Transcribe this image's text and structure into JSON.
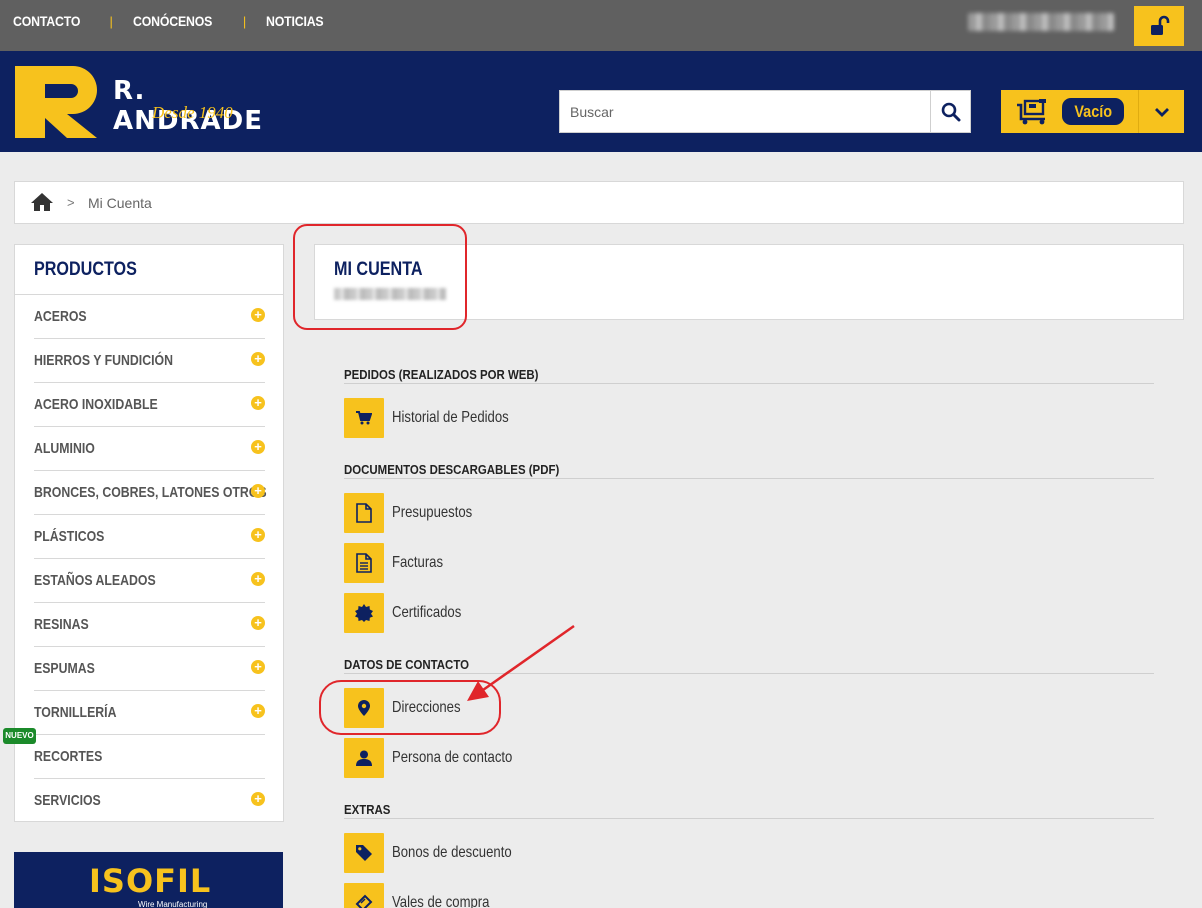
{
  "top_nav": {
    "items": [
      "CONTACTO",
      "CONÓCENOS",
      "NOTICIAS"
    ],
    "separator": "|"
  },
  "brand": {
    "name": "R. ANDRADE",
    "tagline": "Desde 1940"
  },
  "search": {
    "placeholder": "Buscar"
  },
  "cart": {
    "status": "Vacío"
  },
  "breadcrumb": {
    "separator": ">",
    "current": "Mi Cuenta"
  },
  "sidebar": {
    "title": "PRODUCTOS",
    "items": [
      {
        "label": "ACEROS",
        "expandable": true
      },
      {
        "label": "HIERROS Y FUNDICIÓN",
        "expandable": true
      },
      {
        "label": "ACERO INOXIDABLE",
        "expandable": true
      },
      {
        "label": "ALUMINIO",
        "expandable": true
      },
      {
        "label": "BRONCES, COBRES, LATONES OTROS",
        "expandable": true
      },
      {
        "label": "PLÁSTICOS",
        "expandable": true
      },
      {
        "label": "ESTAÑOS ALEADOS",
        "expandable": true
      },
      {
        "label": "RESINAS",
        "expandable": true
      },
      {
        "label": "ESPUMAS",
        "expandable": true
      },
      {
        "label": "TORNILLERÍA",
        "expandable": true
      },
      {
        "label": "RECORTES",
        "expandable": false
      },
      {
        "label": "SERVICIOS",
        "expandable": true
      }
    ],
    "new_badge": "NUEVO"
  },
  "banner": {
    "brand": "ISOFIL",
    "subtitle": "Wire Manufacturing"
  },
  "account": {
    "title": "MI CUENTA",
    "sections": [
      {
        "title": "PEDIDOS (REALIZADOS POR WEB)",
        "links": [
          {
            "label": "Historial de Pedidos",
            "icon": "cart-icon"
          }
        ]
      },
      {
        "title": "DOCUMENTOS DESCARGABLES (PDF)",
        "links": [
          {
            "label": "Presupuestos",
            "icon": "document-icon"
          },
          {
            "label": "Facturas",
            "icon": "document-text-icon"
          },
          {
            "label": "Certificados",
            "icon": "certificate-icon"
          }
        ]
      },
      {
        "title": "DATOS DE CONTACTO",
        "links": [
          {
            "label": "Direcciones",
            "icon": "map-marker-icon"
          },
          {
            "label": "Persona de contacto",
            "icon": "user-icon"
          }
        ]
      },
      {
        "title": "EXTRAS",
        "links": [
          {
            "label": "Bonos de descuento",
            "icon": "tag-icon"
          },
          {
            "label": "Vales de compra",
            "icon": "ticket-icon"
          }
        ]
      }
    ]
  },
  "colors": {
    "brand_navy": "#0d2160",
    "brand_yellow": "#f7c21d",
    "topbar_gray": "#606060",
    "annotation_red": "#e0262b",
    "new_badge_green": "#1b8a2a"
  }
}
